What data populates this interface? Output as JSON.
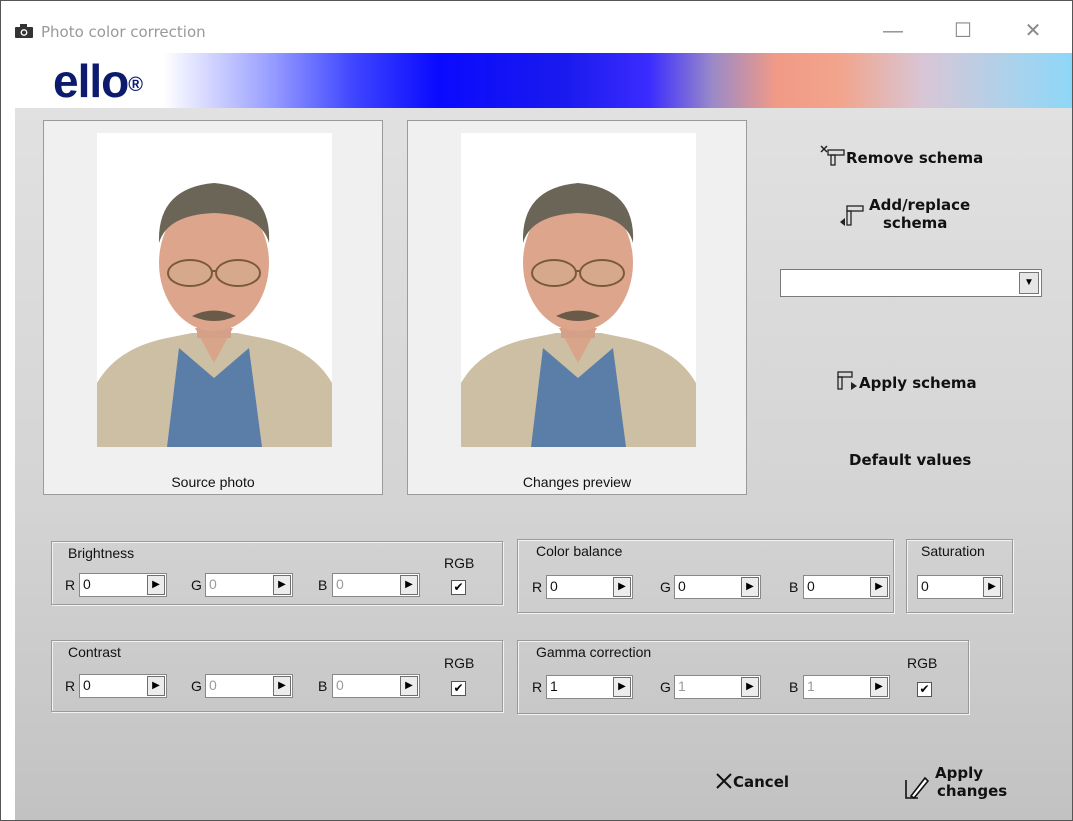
{
  "window": {
    "title": "Photo color correction",
    "controls": {
      "minimize": "—",
      "maximize": "☐",
      "close": "✕"
    }
  },
  "banner": {
    "logo": "ello",
    "logo_mark": "®"
  },
  "photos": {
    "source_caption": "Source photo",
    "preview_caption": "Changes preview"
  },
  "schema": {
    "remove_label": "Remove schema",
    "add_label_line1": "Add/replace",
    "add_label_line2": "schema",
    "combo_value": "",
    "apply_label": "Apply schema",
    "default_label": "Default values"
  },
  "brightness": {
    "title": "Brightness",
    "r_label": "R",
    "g_label": "G",
    "b_label": "B",
    "r": "0",
    "g": "0",
    "b": "0",
    "rgb_label": "RGB",
    "rgb_checked": "✔"
  },
  "contrast": {
    "title": "Contrast",
    "r_label": "R",
    "g_label": "G",
    "b_label": "B",
    "r": "0",
    "g": "0",
    "b": "0",
    "rgb_label": "RGB",
    "rgb_checked": "✔"
  },
  "color_balance": {
    "title": "Color balance",
    "r_label": "R",
    "g_label": "G",
    "b_label": "B",
    "r": "0",
    "g": "0",
    "b": "0"
  },
  "saturation": {
    "title": "Saturation",
    "value": "0"
  },
  "gamma": {
    "title": "Gamma correction",
    "r_label": "R",
    "g_label": "G",
    "b_label": "B",
    "r": "1",
    "g": "1",
    "b": "1",
    "rgb_label": "RGB",
    "rgb_checked": "✔"
  },
  "actions": {
    "cancel_label": "Cancel",
    "apply_line1": "Apply",
    "apply_line2": "changes"
  },
  "spin_arrow": "▶",
  "combo_arrow": "▼",
  "colors": {
    "banner_blue": "#0a0aff",
    "logo": "#0c1b6d",
    "client_bg": "#d4d4d4"
  }
}
